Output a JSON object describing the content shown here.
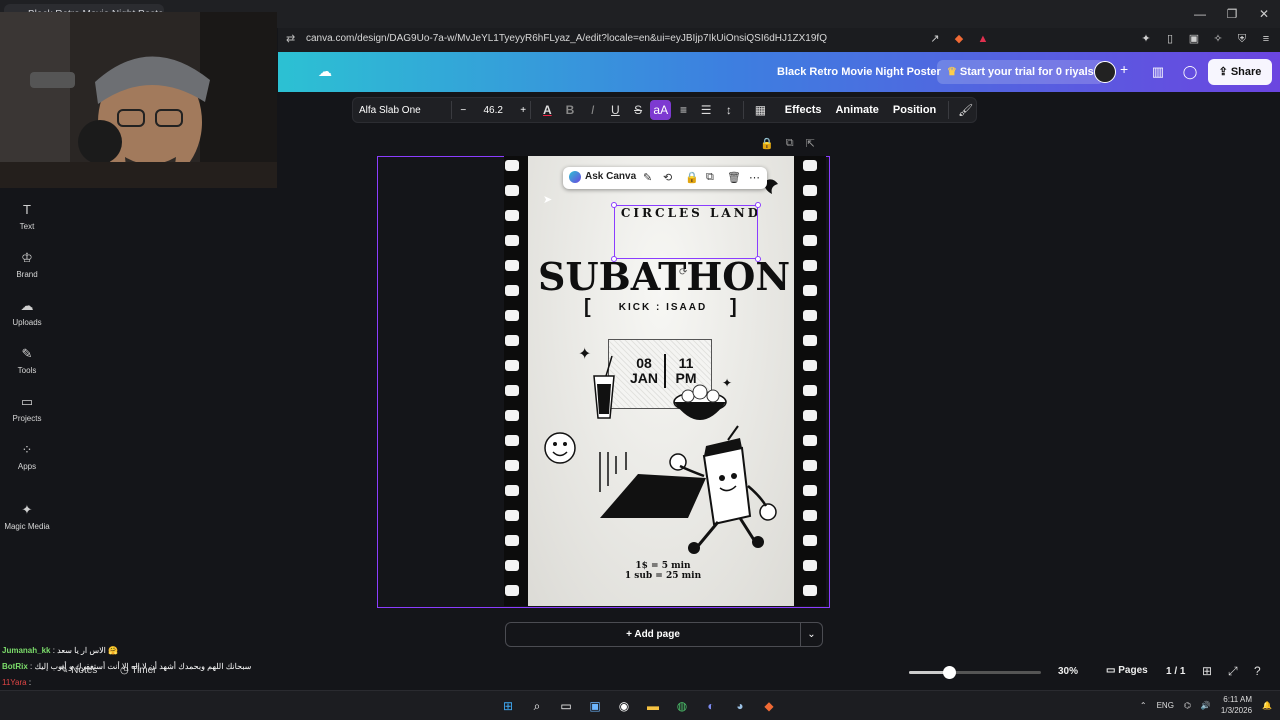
{
  "browser": {
    "tab_title": "Black Retro Movie Night Poster",
    "url": "canva.com/design/DAG9Uo-7a-w/MvJeYL1TyeyyR6hFLyaz_A/edit?locale=en&ui=eyJBIjp7IkUiOnsiQSI6dHJ1ZX19fQ",
    "window_controls": [
      "—",
      "❐",
      "✕"
    ]
  },
  "header": {
    "doc_title": "Black Retro Movie Night Poster",
    "trial_label": "Start your trial for 0 riyals",
    "share_label": "Share"
  },
  "toolbar": {
    "font_name": "Alfa Slab One",
    "font_size": "46.2",
    "minus": "−",
    "plus": "+",
    "effects": "Effects",
    "animate": "Animate",
    "position": "Position"
  },
  "left_rail": [
    {
      "label": "Text",
      "icon": "T"
    },
    {
      "label": "Brand",
      "icon": "♔"
    },
    {
      "label": "Uploads",
      "icon": "☁"
    },
    {
      "label": "Tools",
      "icon": "✎"
    },
    {
      "label": "Projects",
      "icon": "▭"
    },
    {
      "label": "Apps",
      "icon": "⁘"
    },
    {
      "label": "Magic Media",
      "icon": "✦"
    }
  ],
  "ask_canva": {
    "label": "Ask Canva"
  },
  "poster": {
    "circles_land": "CIRCLES LAND",
    "title": "SUBATHON",
    "kick": "KICK : ISAAD",
    "bracket_left": "[",
    "bracket_right": "]",
    "date_day": "08",
    "date_month": "JAN",
    "time_hour": "11",
    "time_ampm": "PM",
    "price_line1": "1$ = 5 min",
    "price_line2": "1 sub = 25 min"
  },
  "add_page_label": "+ Add page",
  "bottom": {
    "zoom": "30%",
    "zoom_level": 0.3,
    "pages_label": "Pages",
    "page_count": "1 / 1",
    "notes_label": "Notes",
    "timer_label": "Timer"
  },
  "chat": [
    {
      "user": "Jumanah_kk",
      "message": ": الاس ار يا سعد 🤗"
    },
    {
      "user": "BotRix",
      "message": ": سبحانك اللهم وبحمدك أشهد أن لا إله إلا أنت أستغفرك و أتوب إليك"
    },
    {
      "user": "11Yara",
      "message": ":"
    }
  ],
  "taskbar": {
    "lang": "ENG",
    "time": "6:11 AM",
    "date": "1/3/2026"
  },
  "colors": {
    "selection": "#8b3dff",
    "header_gradient_start": "#2cc1d3",
    "header_gradient_end": "#6b45e0"
  }
}
